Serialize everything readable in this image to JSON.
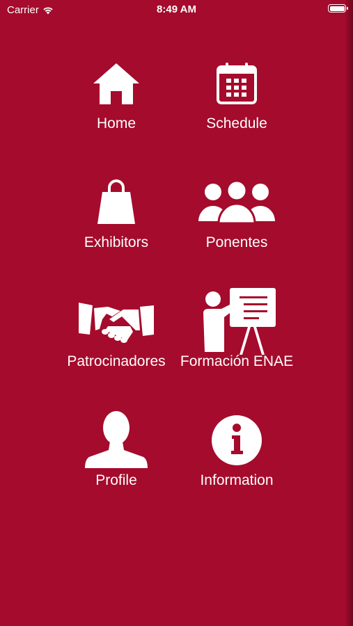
{
  "status_bar": {
    "carrier": "Carrier",
    "time": "8:49 AM"
  },
  "menu": {
    "home": "Home",
    "schedule": "Schedule",
    "exhibitors": "Exhibitors",
    "ponentes": "Ponentes",
    "patrocinadores": "Patrocinadores",
    "formacion": "Formación ENAE",
    "profile": "Profile",
    "information": "Information"
  },
  "colors": {
    "background": "#a50b2c",
    "foreground": "#ffffff"
  },
  "icons": [
    "home-icon",
    "calendar-icon",
    "shopping-bag-icon",
    "group-icon",
    "handshake-icon",
    "presentation-icon",
    "user-icon",
    "info-icon"
  ]
}
